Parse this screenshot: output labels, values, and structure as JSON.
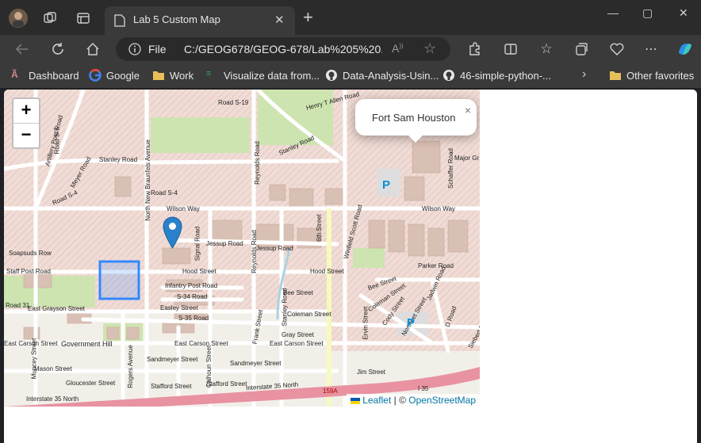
{
  "browser": {
    "tab_title": "Lab 5 Custom Map",
    "address_file_label": "File",
    "address_url": "C:/GEOG678/GEOG-678/Lab%205%20..."
  },
  "bookmarks": [
    {
      "label": "Dashboard",
      "icon": "tamu-icon"
    },
    {
      "label": "Google",
      "icon": "google-icon"
    },
    {
      "label": "Work",
      "icon": "folder-icon"
    },
    {
      "label": "Visualize data from...",
      "icon": "visualize-icon"
    },
    {
      "label": "Data-Analysis-Usin...",
      "icon": "github-icon"
    },
    {
      "label": "46-simple-python-...",
      "icon": "github-icon"
    }
  ],
  "other_favorites": "Other favorites",
  "map": {
    "zoom_in": "+",
    "zoom_out": "−",
    "popup_text": "Fort Sam Houston",
    "popup_close": "×",
    "attribution": {
      "leaflet": "Leaflet",
      "separator": " | © ",
      "osm": "OpenStreetMap"
    },
    "road_labels": [
      "Road S-19",
      "Henry T Allen Road",
      "Stanley Road",
      "Stanley Road",
      "Reynolds Road",
      "Schaffer Road",
      "Major Gr",
      "North New Braunfels Avenue",
      "Road S-4",
      "Road S-4",
      "Wilson Way",
      "Wilson Way",
      "Artillery Post Road",
      "Meyer Road",
      "Road S-5",
      "Soapsuds Row",
      "Staff Post Road",
      "Signal Road",
      "Jessup Road",
      "Jessup Road",
      "Reynolds Road",
      "6th Street",
      "Winfield Scott Road",
      "Parker Road",
      "Jadwin Road",
      "Hood Street",
      "Hood Street",
      "Infantry Post Road",
      "S-34 Road",
      "Easley Street",
      "S-35 Road",
      "East Grayson Street",
      "Road 31",
      "Bee Street",
      "Coleman Street",
      "Bee Street",
      "Coleman Street",
      "Cody Street",
      "Northeet Street",
      "D Road",
      "Ervin Street",
      "Stanley Road",
      "Gray Street",
      "East Carson Street",
      "East Carson Street",
      "East Carson Street",
      "Government Hill",
      "Muncey Street",
      "Mason Street",
      "Gloucester Street",
      "Rogers Avenue",
      "Sandmeyer Street",
      "Sandmeyer Street",
      "Stafford Street",
      "Stafford Street",
      "Calhoun Street",
      "Frank Street",
      "Jim Street",
      "Interstate 35 North",
      "Interstate 35 North",
      "I 35",
      "159A",
      "Siebert Ro",
      "Gloucester Street"
    ]
  }
}
